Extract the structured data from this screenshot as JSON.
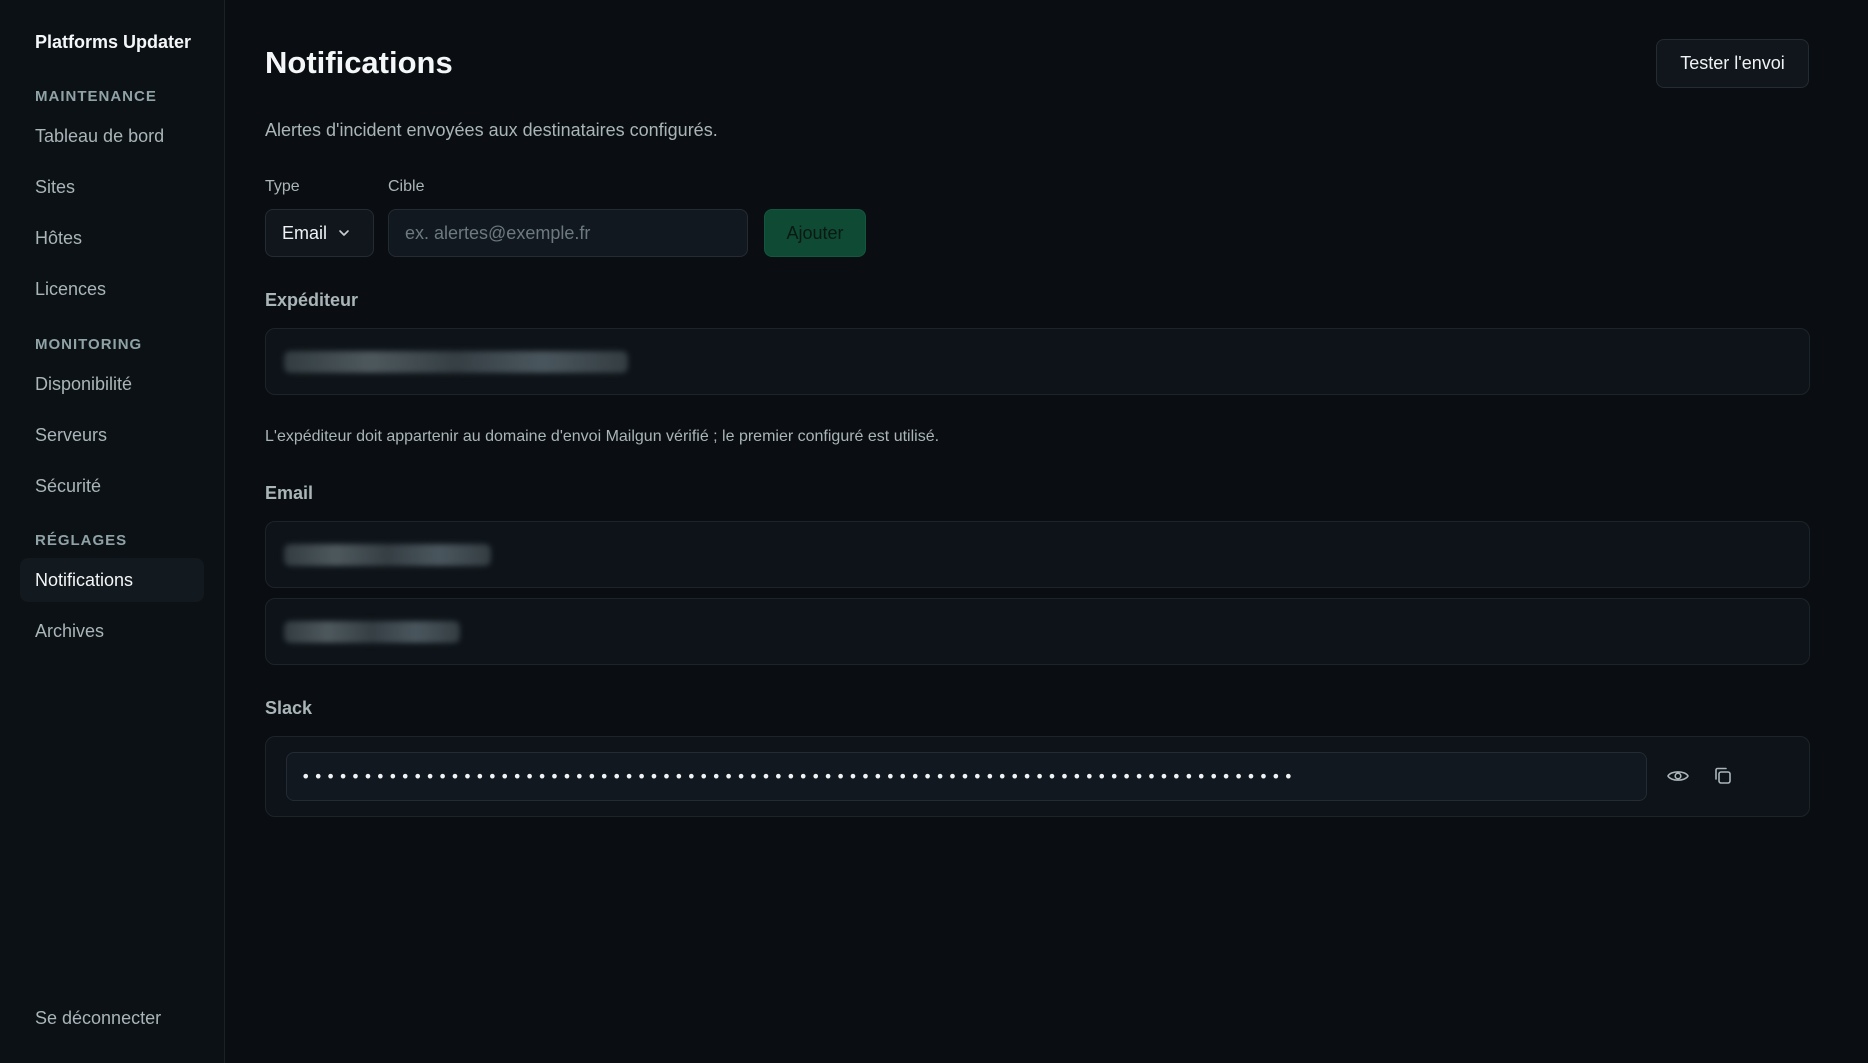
{
  "app": {
    "title": "Platforms Updater"
  },
  "sidebar": {
    "sections": [
      {
        "label": "MAINTENANCE",
        "items": [
          "Tableau de bord",
          "Sites",
          "Hôtes",
          "Licences"
        ]
      },
      {
        "label": "MONITORING",
        "items": [
          "Disponibilité",
          "Serveurs",
          "Sécurité"
        ]
      },
      {
        "label": "RÉGLAGES",
        "items": [
          "Notifications",
          "Archives"
        ]
      }
    ],
    "active_item": "Notifications",
    "logout_label": "Se déconnecter"
  },
  "page": {
    "title": "Notifications",
    "subtitle": "Alertes d'incident envoyées aux destinataires configurés.",
    "test_button": "Tester l'envoi"
  },
  "form": {
    "type_label": "Type",
    "type_value": "Email",
    "target_label": "Cible",
    "target_placeholder": "ex. alertes@exemple.fr",
    "add_button": "Ajouter"
  },
  "sender": {
    "heading": "Expéditeur",
    "hint": "L'expéditeur doit appartenir au domaine d'envoi Mailgun vérifié ; le premier configuré est utilisé."
  },
  "email": {
    "heading": "Email"
  },
  "slack": {
    "heading": "Slack",
    "masked_value": "••••••••••••••••••••••••••••••••••••••••••••••••••••••••••••••••••••••••••••••••"
  },
  "icons": {
    "chevron": "chevron-down-icon",
    "eye": "eye-icon",
    "copy": "copy-icon"
  }
}
